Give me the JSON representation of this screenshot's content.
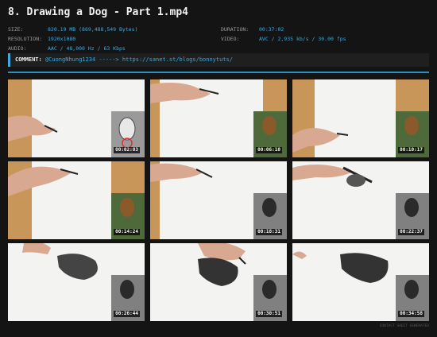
{
  "title": "8. Drawing a Dog - Part 1.mp4",
  "meta": {
    "size_label": "SIZE:",
    "size_value": "820.19 MB (869,488,549 Bytes)",
    "resolution_label": "RESOLUTION:",
    "resolution_value": "1920x1080",
    "audio_label": "AUDIO:",
    "audio_value": "AAC / 48,000 Hz / 63 Kbps",
    "duration_label": "DURATION:",
    "duration_value": "00:37:02",
    "video_label": "VIDEO:",
    "video_value": "AVC / 2,935 kb/s / 30.00 fps"
  },
  "comment": {
    "label": "COMMENT:",
    "user": "@CuongNhung1234",
    "arrow": "----->",
    "url": "https://sanet.st/blogs/bonnytuts/"
  },
  "thumbs": [
    {
      "time": "00:02:03"
    },
    {
      "time": "00:06:10"
    },
    {
      "time": "00:10:17"
    },
    {
      "time": "00:14:24"
    },
    {
      "time": "00:18:31"
    },
    {
      "time": "00:22:37"
    },
    {
      "time": "00:26:44"
    },
    {
      "time": "00:30:51"
    },
    {
      "time": "00:34:58"
    }
  ],
  "footer": "CONTACT SHEET GENERATED"
}
